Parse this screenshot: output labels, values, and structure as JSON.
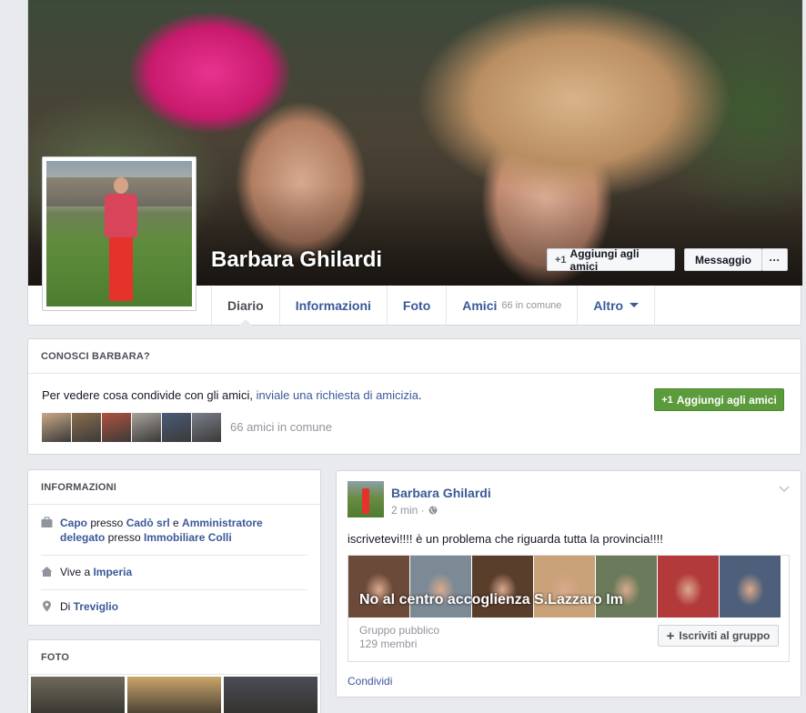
{
  "profile": {
    "name": "Barbara Ghilardi",
    "add_friend_label": "Aggiungi agli amici",
    "message_label": "Messaggio",
    "more_label": "···",
    "plus_glyph": "+1"
  },
  "tabs": [
    {
      "label": "Diario"
    },
    {
      "label": "Informazioni"
    },
    {
      "label": "Foto"
    },
    {
      "label": "Amici",
      "sub": "66 in comune"
    },
    {
      "label": "Altro"
    }
  ],
  "know": {
    "heading": "CONOSCI BARBARA?",
    "text_before": "Per vedere cosa condivide con gli amici, ",
    "link": "inviale una richiesta di amicizia",
    "text_after": ".",
    "button": "Aggiungi agli amici",
    "mutual": "66 amici in comune",
    "avatar_colors": [
      "#c9a888",
      "#8a6d4f",
      "#b0523f",
      "#a7a29b",
      "#4a5b7a",
      "#7a7f8a"
    ]
  },
  "info": {
    "heading": "INFORMAZIONI",
    "work": {
      "role1": "Capo",
      "p1": " presso ",
      "company1": "Cadò srl",
      "and": " e ",
      "role2": "Amministratore delegato",
      "p2": " presso ",
      "company2": "Immobiliare Colli"
    },
    "lives": {
      "prefix": "Vive a ",
      "place": "Imperia"
    },
    "from": {
      "prefix": "Di ",
      "place": "Treviglio"
    }
  },
  "foto": {
    "heading": "FOTO",
    "thumb_colors": [
      "#6f6a5c",
      "#caa56a",
      "#4b4d55"
    ]
  },
  "post": {
    "author": "Barbara Ghilardi",
    "time": "2 min ·",
    "text": "iscrivetevi!!!! è un problema che riguarda tutta la provincia!!!!",
    "group": {
      "title": "No al centro accoglienza S.Lazzaro Im",
      "type": "Gruppo pubblico",
      "members": "129 membri",
      "join_label": "Iscriviti al gruppo",
      "photo_colors": [
        "#6b4a3a",
        "#7c8a96",
        "#5a3e2c",
        "#c9a27a",
        "#6a7a5a",
        "#b23a3a",
        "#4d5f7a"
      ]
    },
    "share": "Condividi"
  },
  "colors": {
    "link": "#3b5998",
    "green": "#5b9b3b",
    "bg": "#e9eaed"
  }
}
